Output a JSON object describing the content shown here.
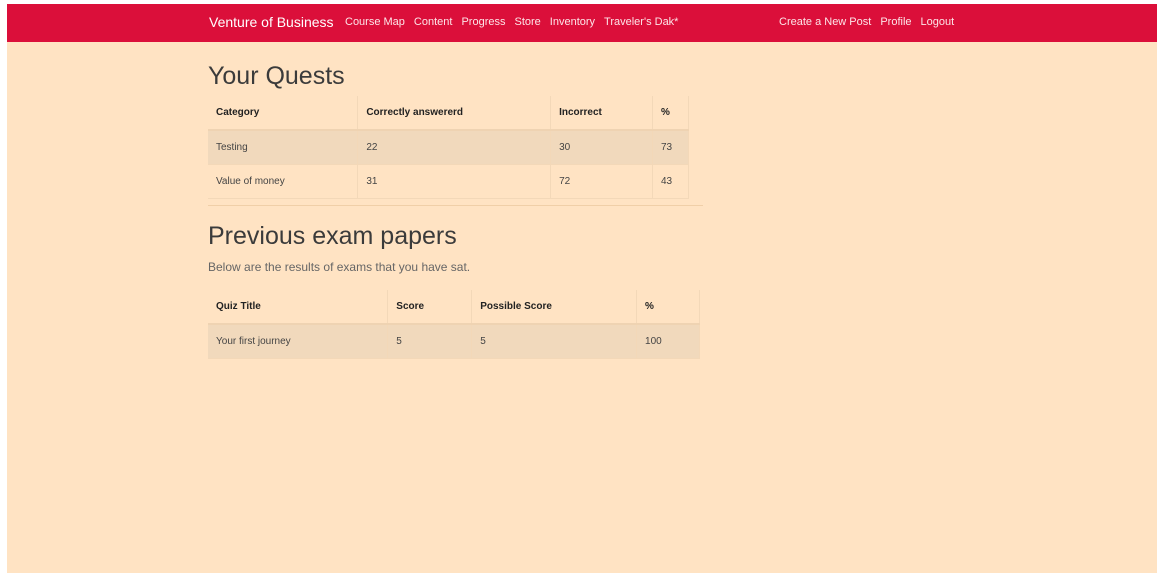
{
  "nav": {
    "brand": "Venture of Business",
    "left": [
      "Course Map",
      "Content",
      "Progress",
      "Store",
      "Inventory",
      "Traveler's Dak*"
    ],
    "right": [
      "Create a New Post",
      "Profile",
      "Logout"
    ]
  },
  "quests": {
    "title": "Your Quests",
    "headers": [
      "Category",
      "Correctly answererd",
      "Incorrect",
      "%"
    ],
    "rows": [
      [
        "Testing",
        "22",
        "30",
        "73"
      ],
      [
        "Value of money",
        "31",
        "72",
        "43"
      ]
    ]
  },
  "exams": {
    "title": "Previous exam papers",
    "lead": "Below are the results of exams that you have sat.",
    "headers": [
      "Quiz Title",
      "Score",
      "Possible Score",
      "%"
    ],
    "rows": [
      [
        "Your first journey",
        "5",
        "5",
        "100"
      ]
    ]
  },
  "colors": {
    "navbar": "#db0f3a",
    "page_background": "#ffe3c3",
    "stripe": "#f1d9bc"
  }
}
